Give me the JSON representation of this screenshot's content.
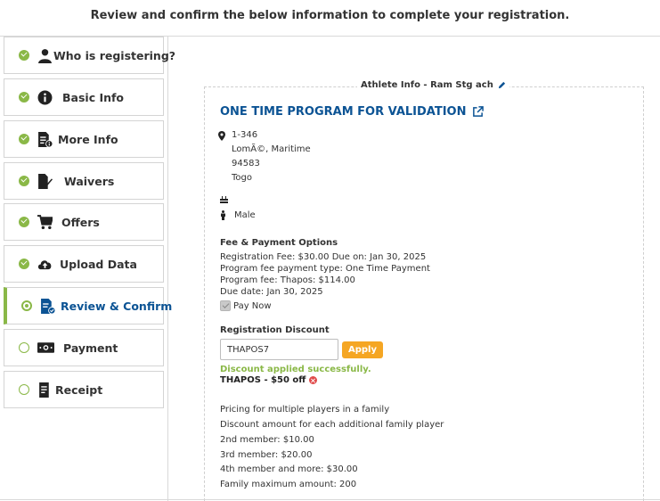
{
  "header": {
    "title": "Review and confirm the below information to complete your registration."
  },
  "colors": {
    "accent_green": "#8ab847",
    "link_blue": "#0b5394",
    "apply_orange": "#f5a623",
    "error_red": "#e04b4b"
  },
  "steps": [
    {
      "label": "Who is registering?",
      "icon": "user-icon",
      "state": "done"
    },
    {
      "label": "Basic Info",
      "icon": "info-circle-icon",
      "state": "done"
    },
    {
      "label": "More Info",
      "icon": "document-info-icon",
      "state": "done"
    },
    {
      "label": "Waivers",
      "icon": "document-sign-icon",
      "state": "done"
    },
    {
      "label": "Offers",
      "icon": "cart-icon",
      "state": "done"
    },
    {
      "label": "Upload Data",
      "icon": "cloud-upload-icon",
      "state": "done"
    },
    {
      "label": "Review & Confirm",
      "icon": "document-check-icon",
      "state": "current"
    },
    {
      "label": "Payment",
      "icon": "cash-icon",
      "state": "pending"
    },
    {
      "label": "Receipt",
      "icon": "receipt-icon",
      "state": "pending"
    }
  ],
  "athlete": {
    "legend": "Athlete Info - Ram Stg ach",
    "program_title": "ONE TIME PROGRAM FOR VALIDATION",
    "address": [
      "1-346",
      "LomÃ©, Maritime",
      "94583",
      "Togo"
    ],
    "gender": "Male"
  },
  "fees": {
    "heading": "Fee & Payment Options",
    "lines": [
      "Registration Fee: $30.00   Due on: Jan 30, 2025",
      "Program fee payment type: One Time Payment",
      "Program fee: Thapos: $114.00",
      "Due date: Jan 30, 2025"
    ],
    "pay_now": "Pay Now"
  },
  "discount": {
    "heading": "Registration Discount",
    "code_value": "THAPOS7",
    "apply_label": "Apply",
    "success_msg": "Discount applied successfully.",
    "applied_text": "THAPOS - $50 off"
  },
  "multi_player": [
    "Pricing for multiple players in a family",
    "Discount amount for each additional family player",
    "2nd member: $10.00",
    "3rd member: $20.00",
    "4th member and more: $30.00",
    "Family maximum amount: 200"
  ]
}
